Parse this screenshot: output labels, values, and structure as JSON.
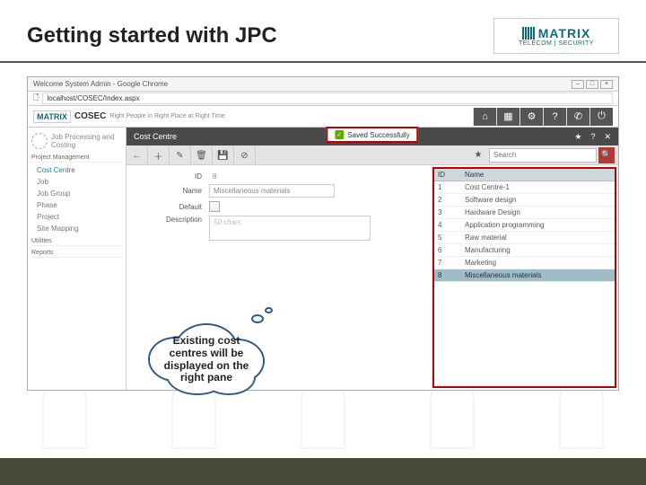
{
  "slide": {
    "title": "Getting started with JPC"
  },
  "brand": {
    "name": "MATRIX",
    "sub": "TELECOM | SECURITY"
  },
  "browser": {
    "title": "Welcome System Admin - Google Chrome",
    "url": "localhost/COSEC/Index.aspx"
  },
  "app": {
    "product": "COSEC",
    "tagline": "Right People in Right Place at Right Time",
    "small_logo": "MATRIX"
  },
  "topnav_icons": [
    "home",
    "grid",
    "gear",
    "ques",
    "phone",
    "power"
  ],
  "module": {
    "title": "Job Processing and Costing"
  },
  "sidebar": {
    "section1": "Project Management",
    "items1": [
      "Cost Centre",
      "Job",
      "Job Group",
      "Phase",
      "Project",
      "Site Mapping"
    ],
    "section2": "Utilities",
    "section3": "Reports"
  },
  "crumb": {
    "title": "Cost Centre"
  },
  "toast": {
    "text": "Saved Successfully"
  },
  "toolbar": {
    "icons": [
      "back",
      "add",
      "edit",
      "del",
      "save",
      "cancel"
    ],
    "search_ph": "Search"
  },
  "form": {
    "id_label": "ID",
    "id_value": "8",
    "name_label": "Name",
    "name_value": "Miscellaneous materials",
    "default_label": "Default",
    "desc_label": "Description",
    "desc_ph": "50 chars"
  },
  "list": {
    "cols": [
      "ID",
      "Name"
    ],
    "rows": [
      {
        "id": "1",
        "name": "Cost Centre-1"
      },
      {
        "id": "2",
        "name": "Software design"
      },
      {
        "id": "3",
        "name": "Hardware Design"
      },
      {
        "id": "4",
        "name": "Application programming"
      },
      {
        "id": "5",
        "name": "Raw material"
      },
      {
        "id": "6",
        "name": "Manufacturing"
      },
      {
        "id": "7",
        "name": "Marketing"
      },
      {
        "id": "8",
        "name": "Miscellaneous materials"
      }
    ]
  },
  "callout": {
    "text": "Existing cost centres will be displayed on the right pane"
  }
}
